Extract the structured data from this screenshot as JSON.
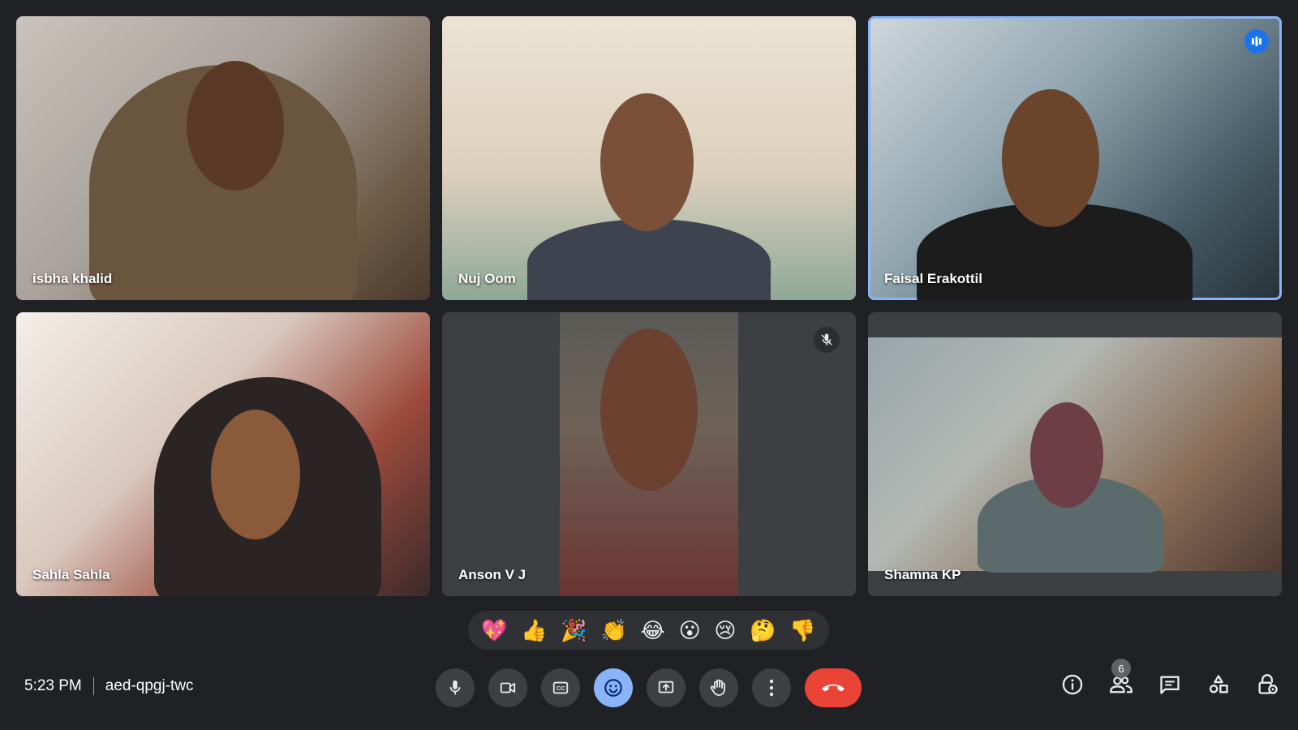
{
  "participants": [
    {
      "name": "isbha khalid"
    },
    {
      "name": "Nuj Oom"
    },
    {
      "name": "Faisal Erakottil"
    },
    {
      "name": "Sahla Sahla"
    },
    {
      "name": "Anson V J"
    },
    {
      "name": "Shamna KP"
    }
  ],
  "reactions": [
    "💖",
    "👍",
    "🎉",
    "👏",
    "😂",
    "😮",
    "😢",
    "🤔",
    "👎"
  ],
  "meeting": {
    "time": "5:23 PM",
    "code": "aed-qpgj-twc"
  },
  "people_count": "6",
  "colors": {
    "background": "#202124",
    "tile": "#3c4043",
    "active_outline": "#8ab4f8",
    "hangup": "#ea4335",
    "reactions_active": "#8ab4f8"
  },
  "icons": {
    "controls": [
      "mic-icon",
      "camera-icon",
      "captions-icon",
      "emoji-icon",
      "present-icon",
      "raise-hand-icon",
      "more-options-icon",
      "hangup-icon"
    ],
    "right": [
      "info-icon",
      "people-icon",
      "chat-icon",
      "activities-icon",
      "host-controls-icon"
    ]
  }
}
